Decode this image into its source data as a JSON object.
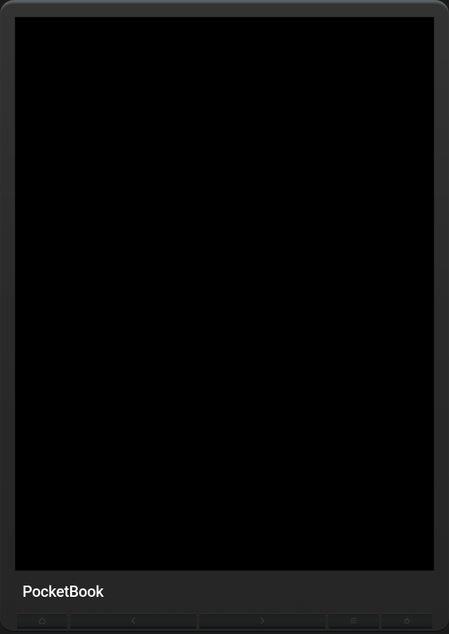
{
  "device": {
    "brand": "PocketBook",
    "screen_state": "off"
  },
  "buttons": {
    "home": "home",
    "prev": "prev-page",
    "next": "next-page",
    "menu": "menu",
    "power": "power"
  }
}
